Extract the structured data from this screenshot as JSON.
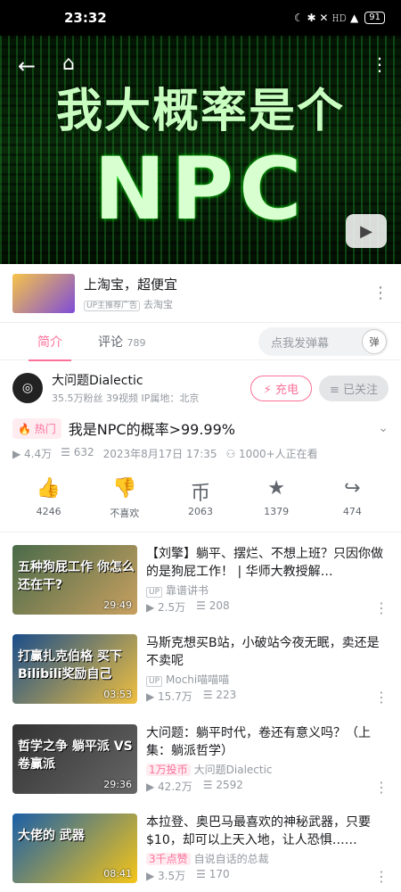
{
  "status": {
    "time": "23:32",
    "battery": "91",
    "signal_icons": "☾ ✱ ✕ 𝙷𝙳 ▲"
  },
  "video": {
    "title_line1": "我大概率是个",
    "title_line2": "NPC"
  },
  "ad": {
    "title": "上淘宝，超便宜",
    "tag": "UP主推荐广告",
    "source": "去淘宝"
  },
  "tabs": {
    "intro": "简介",
    "comments": "评论",
    "comment_count": "789",
    "danmaku_placeholder": "点我发弹幕",
    "danmaku_icon": "弹"
  },
  "uploader": {
    "name": "大问题Dialectic",
    "fans": "35.5万粉丝",
    "videos": "39视频",
    "location": "IP属地：北京",
    "charge": "充电",
    "follow": "已关注"
  },
  "title": {
    "badge": "热门",
    "text": "我是NPC的概率>99.99%"
  },
  "meta": {
    "views": "4.4万",
    "danmaku": "632",
    "date": "2023年8月17日 17:35",
    "watching": "1000+人正在看"
  },
  "actions": [
    {
      "label": "4246",
      "icon": "👍"
    },
    {
      "label": "不喜欢",
      "icon": "👎"
    },
    {
      "label": "2063",
      "icon": "币"
    },
    {
      "label": "1379",
      "icon": "★"
    },
    {
      "label": "474",
      "icon": "↪"
    }
  ],
  "recommendations": [
    {
      "title": "【刘擎】躺平、摆烂、不想上班？只因你做的是狗屁工作！ | 华师大教授解…",
      "up": "靠谱讲书",
      "views": "2.5万",
      "danmaku": "208",
      "duration": "29:49",
      "thumb_text": "五种狗屁工作 你怎么还在干?",
      "colors": [
        "#4a6b4a",
        "#c8a060"
      ]
    },
    {
      "title": "马斯克想买B站，小破站今夜无眠，卖还是不卖呢",
      "up": "Mochi喵喵喵",
      "views": "15.7万",
      "danmaku": "223",
      "duration": "03:53",
      "thumb_text": "打赢扎克伯格 买下Bilibili奖励自己",
      "colors": [
        "#1a4d8a",
        "#f0c040"
      ]
    },
    {
      "title": "大问题：躺平时代，卷还有意义吗？（上集：躺派哲学）",
      "up": "大问题Dialectic",
      "pill": "1万投币",
      "views": "42.2万",
      "danmaku": "2592",
      "duration": "29:36",
      "thumb_text": "哲学之争 躺平派 VS 卷赢派",
      "colors": [
        "#333333",
        "#666666"
      ]
    },
    {
      "title": "本拉登、奥巴马最喜欢的神秘武器，只要$10，却可以上天入地，让人恐惧……",
      "up": "自说自话的总裁",
      "pill": "3千点赞",
      "views": "3.5万",
      "danmaku": "170",
      "duration": "08:41",
      "thumb_text": "大佬的 武器",
      "colors": [
        "#1a5fa8",
        "#f5c518"
      ]
    }
  ]
}
